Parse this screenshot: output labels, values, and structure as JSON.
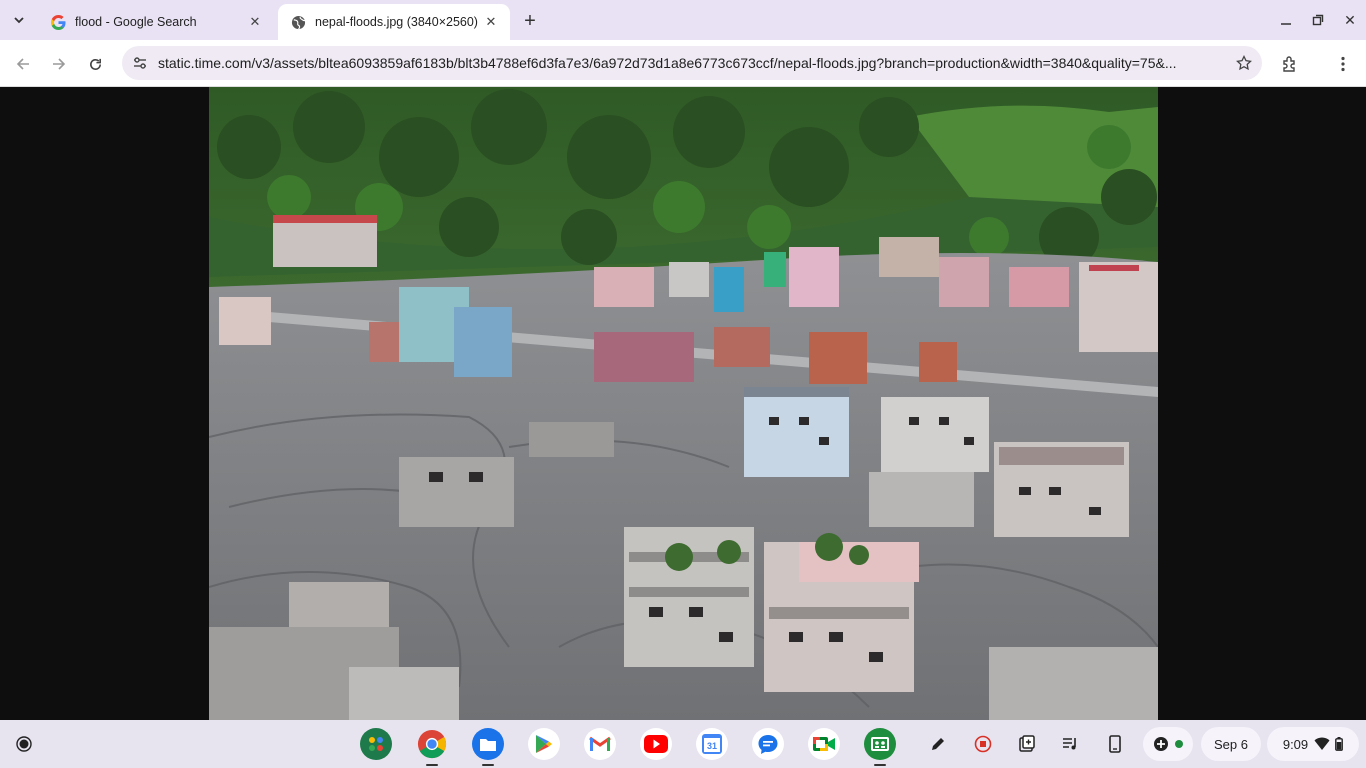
{
  "tabs": [
    {
      "title": "flood - Google Search",
      "favicon": "google-g-icon",
      "active": false
    },
    {
      "title": "nepal-floods.jpg (3840×2560)",
      "favicon": "globe-icon",
      "active": true
    }
  ],
  "toolbar": {
    "url": "static.time.com/v3/assets/bltea6093859af6183b/blt3b4788ef6d3fa7e3/6a972d73d1a8e6773c673ccf/nepal-floods.jpg?branch=production&width=3840&quality=75&..."
  },
  "shelf": {
    "apps": [
      "app-grid-icon",
      "chrome-icon",
      "files-icon",
      "play-store-icon",
      "gmail-icon",
      "youtube-icon",
      "calendar-icon",
      "messages-icon",
      "meet-icon",
      "classroom-icon"
    ],
    "calendar_day": "31",
    "date": "Sep 6",
    "time": "9:09"
  }
}
